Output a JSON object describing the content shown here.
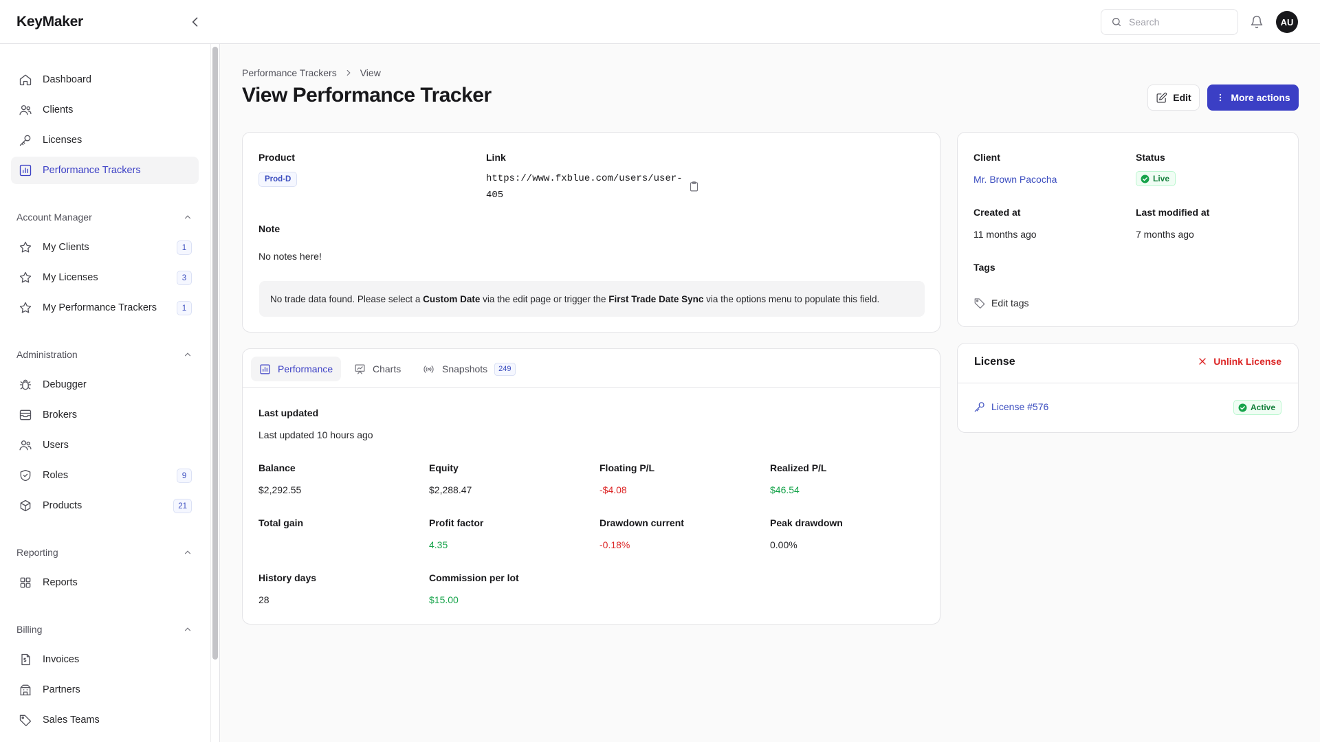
{
  "app": {
    "brand": "KeyMaker"
  },
  "topbar": {
    "search_placeholder": "Search",
    "avatar_initials": "AU"
  },
  "sidebar": {
    "main_items": [
      {
        "label": "Dashboard",
        "icon": "home-icon"
      },
      {
        "label": "Clients",
        "icon": "users-icon"
      },
      {
        "label": "Licenses",
        "icon": "key-icon"
      },
      {
        "label": "Performance Trackers",
        "icon": "chart-icon",
        "active": true
      }
    ],
    "groups": [
      {
        "title": "Account Manager",
        "items": [
          {
            "label": "My Clients",
            "badge": "1",
            "icon": "star-icon"
          },
          {
            "label": "My Licenses",
            "badge": "3",
            "icon": "star-icon"
          },
          {
            "label": "My Performance Trackers",
            "badge": "1",
            "icon": "star-icon"
          }
        ]
      },
      {
        "title": "Administration",
        "items": [
          {
            "label": "Debugger",
            "icon": "bug-icon"
          },
          {
            "label": "Brokers",
            "icon": "inbox-icon"
          },
          {
            "label": "Users",
            "icon": "users-icon"
          },
          {
            "label": "Roles",
            "badge": "9",
            "icon": "shield-icon"
          },
          {
            "label": "Products",
            "badge": "21",
            "icon": "cube-icon"
          }
        ]
      },
      {
        "title": "Reporting",
        "items": [
          {
            "label": "Reports",
            "icon": "grid-icon"
          }
        ]
      },
      {
        "title": "Billing",
        "items": [
          {
            "label": "Invoices",
            "icon": "invoice-icon"
          },
          {
            "label": "Partners",
            "icon": "building-icon"
          },
          {
            "label": "Sales Teams",
            "icon": "tag-icon"
          }
        ]
      }
    ]
  },
  "header": {
    "breadcrumb": [
      "Performance Trackers",
      "View"
    ],
    "title": "View Performance Tracker",
    "edit_label": "Edit",
    "more_label": "More actions"
  },
  "details": {
    "product_label": "Product",
    "product_value": "Prod-D",
    "link_label": "Link",
    "link_line1": "https://www.fxblue.com/users/user-",
    "link_line2": "405",
    "note_label": "Note",
    "note_value": "No notes here!",
    "notice": {
      "part1": "No trade data found. Please select a ",
      "bold1": "Custom Date",
      "part2": " via the edit page or trigger the ",
      "bold2": "First Trade Date Sync",
      "part3": " via the options menu to populate this field."
    }
  },
  "tabs": {
    "items": [
      {
        "label": "Performance",
        "active": true
      },
      {
        "label": "Charts"
      },
      {
        "label": "Snapshots",
        "count": "249"
      }
    ]
  },
  "performance": {
    "last_updated_label": "Last updated",
    "last_updated_value": "Last updated 10 hours ago",
    "metrics": [
      {
        "label": "Balance",
        "value": "$2,292.55",
        "tone": "neutral"
      },
      {
        "label": "Equity",
        "value": "$2,288.47",
        "tone": "neutral"
      },
      {
        "label": "Floating P/L",
        "value": "-$4.08",
        "tone": "negative"
      },
      {
        "label": "Realized P/L",
        "value": "$46.54",
        "tone": "positive"
      },
      {
        "label": "Total gain",
        "value": "",
        "tone": "neutral"
      },
      {
        "label": "Profit factor",
        "value": "4.35",
        "tone": "positive"
      },
      {
        "label": "Drawdown current",
        "value": "-0.18%",
        "tone": "negative"
      },
      {
        "label": "Peak drawdown",
        "value": "0.00%",
        "tone": "neutral"
      },
      {
        "label": "History days",
        "value": "28",
        "tone": "neutral"
      },
      {
        "label": "Commission per lot",
        "value": "$15.00",
        "tone": "positive"
      }
    ]
  },
  "client_card": {
    "client_label": "Client",
    "client_value": "Mr. Brown Pacocha",
    "status_label": "Status",
    "status_value": "Live",
    "created_label": "Created at",
    "created_value": "11 months ago",
    "modified_label": "Last modified at",
    "modified_value": "7 months ago",
    "tags_label": "Tags",
    "edit_tags_label": "Edit tags"
  },
  "license_card": {
    "title": "License",
    "unlink_label": "Unlink License",
    "license_link": "License #576",
    "license_status": "Active"
  },
  "colors": {
    "accent": "#3b3fc5",
    "positive": "#16a34a",
    "negative": "#dc2626",
    "border": "#e4e4e7"
  }
}
